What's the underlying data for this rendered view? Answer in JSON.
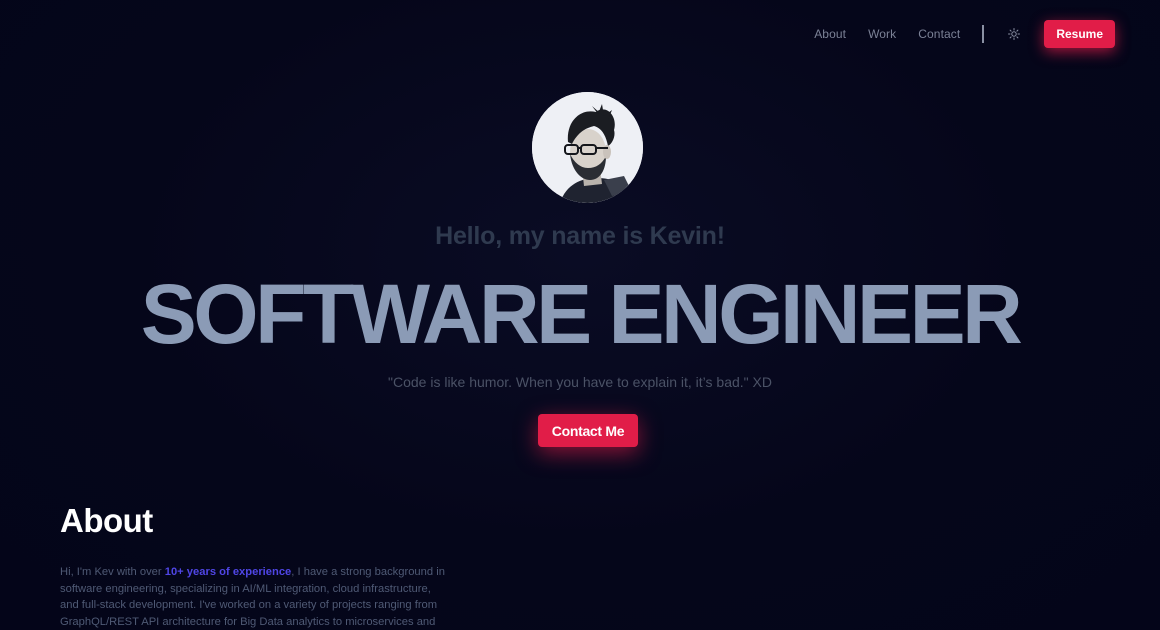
{
  "nav": {
    "links": [
      "About",
      "Work",
      "Contact"
    ],
    "theme_icon": "sun-icon",
    "resume_label": "Resume"
  },
  "hero": {
    "avatar_icon": "profile-photo",
    "greeting": "Hello, my name is Kevin!",
    "title": "SOFTWARE ENGINEER",
    "quote": "\"Code is like humor. When you have to explain it, it’s bad.\" XD",
    "contact_label": "Contact Me"
  },
  "about": {
    "heading": "About",
    "text_before": "Hi, I'm Kev with over ",
    "highlight": "10+ years of experience",
    "text_after": ", I have a strong background in software engineering, specializing in AI/ML integration, cloud infrastructure, and full-stack development. I've worked on a variety of projects ranging from GraphQL/REST API architecture for Big Data analytics to microservices and"
  },
  "colors": {
    "background": "#040519",
    "accent": "#e11d48",
    "highlight": "#4f46e5",
    "title": "#8b9bb6"
  }
}
